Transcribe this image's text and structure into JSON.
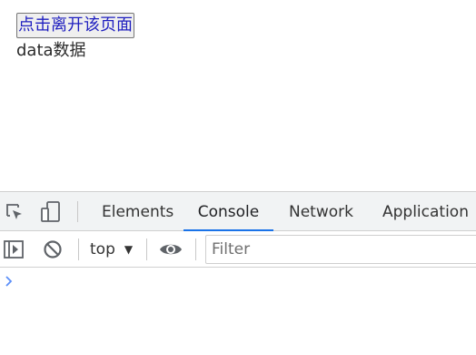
{
  "page": {
    "leave_button_label": "点击离开该页面",
    "data_text": "data数据"
  },
  "devtools": {
    "tabs": [
      {
        "label": "Elements",
        "active": false
      },
      {
        "label": "Console",
        "active": true
      },
      {
        "label": "Network",
        "active": false
      },
      {
        "label": "Application",
        "active": false
      }
    ],
    "toolbar": {
      "context": "top",
      "filter_placeholder": "Filter",
      "filter_value": ""
    },
    "icons": {
      "inspect": "inspect-element-icon",
      "device": "device-toolbar-icon",
      "sidebar": "show-console-sidebar-icon",
      "clear": "clear-console-icon",
      "context_arrow": "dropdown-arrow-icon",
      "live_expression": "eye-icon",
      "prompt": "console-prompt-chevron-icon"
    },
    "colors": {
      "active_tab_underline": "#1a73e8",
      "prompt_chevron": "#5b8ff9"
    }
  }
}
